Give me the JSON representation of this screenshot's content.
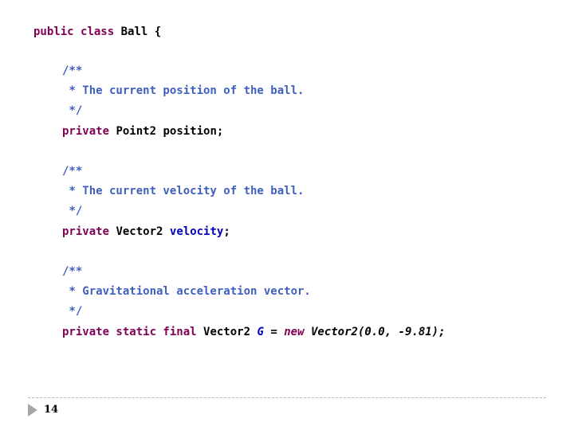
{
  "code": {
    "class_decl": {
      "kw1": "public",
      "kw2": "class",
      "name": "Ball",
      "brace": "{"
    },
    "fields": [
      {
        "doc_open": "/**",
        "doc_text": " * The current position of the ball.",
        "doc_close": " */",
        "modifiers": "private",
        "type": "Point2",
        "name": "position",
        "semicolon": ";"
      },
      {
        "doc_open": "/**",
        "doc_text": " * The current velocity of the ball.",
        "doc_close": " */",
        "modifiers": "private",
        "type": "Vector2",
        "name": "velocity",
        "semicolon": ";"
      },
      {
        "doc_open": "/**",
        "doc_text": " * Gravitational acceleration vector.",
        "doc_close": " */",
        "modifiers": "private static final",
        "type": "Vector2",
        "name": "G",
        "assign": "=",
        "new_kw": "new",
        "initializer": "Vector2(0.0, -9.81);"
      }
    ]
  },
  "footer": {
    "slide_number": "14"
  },
  "colors": {
    "keyword": "#7f0055",
    "javadoc": "#3f5fbf",
    "field": "#0000c0",
    "text": "#000000",
    "marker": "#a6a6a6"
  }
}
